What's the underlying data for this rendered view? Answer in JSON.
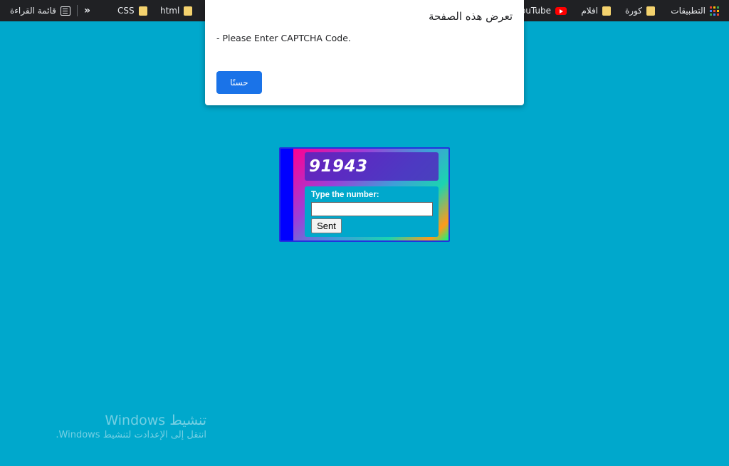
{
  "bookmarks": {
    "apps_label": "التطبيقات",
    "items": [
      {
        "label": "كورة",
        "icon": "folder-icon"
      },
      {
        "label": "افلام",
        "icon": "folder-icon"
      },
      {
        "label": "ouTube",
        "icon": "youtube-icon"
      },
      {
        "label": "html",
        "icon": "folder-icon"
      },
      {
        "label": "CSS",
        "icon": "folder-icon"
      }
    ],
    "more_label": "»",
    "reading_list_label": "قائمة القراءة"
  },
  "dialog": {
    "title": "تعرض هذه الصفحة",
    "message": "- Please Enter CAPTCHA Code.",
    "ok_label": "حسنًا"
  },
  "captcha": {
    "code": "91943",
    "prompt": "Type the number:",
    "input_value": "",
    "submit_label": "Sent"
  },
  "watermark": {
    "title": "تنشيط Windows",
    "subtitle": "انتقل إلى الإعدادت لتنشيط Windows."
  },
  "colors": {
    "page_bg": "#00a8cc",
    "bookmark_bar_bg": "#202124",
    "dialog_button": "#1a73e8",
    "captcha_frame": "#0000ff"
  }
}
